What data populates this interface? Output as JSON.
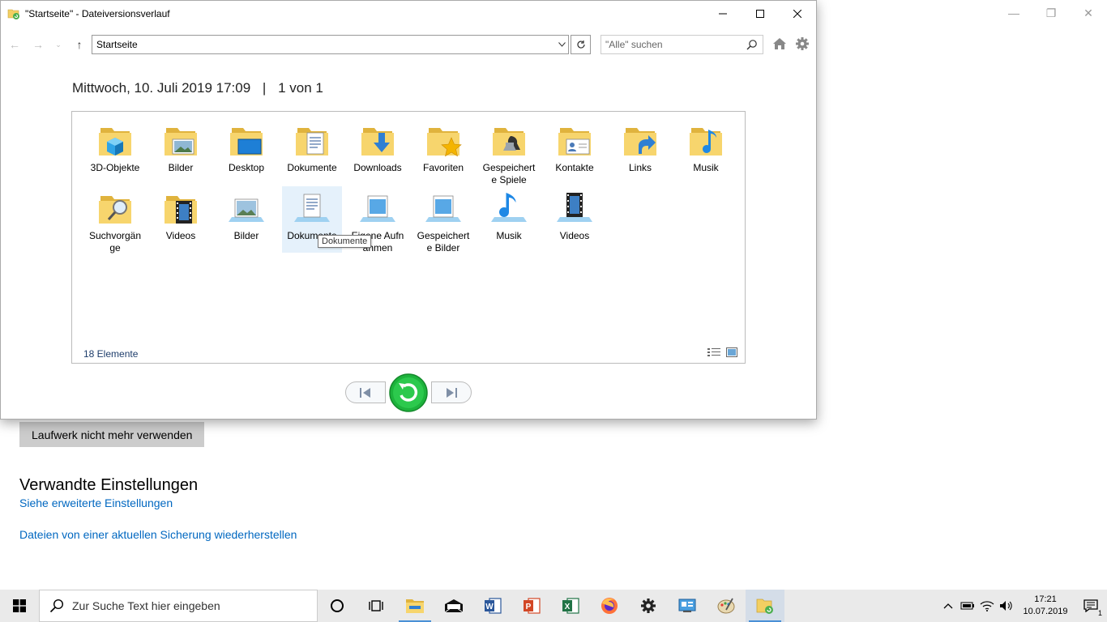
{
  "settings_app": {
    "drive_button": "Laufwerk nicht mehr verwenden",
    "related_title": "Verwandte Einstellungen",
    "link_advanced": "Siehe erweiterte Einstellungen",
    "link_restore": "Dateien von einer aktuellen Sicherung wiederherstellen"
  },
  "window": {
    "title": "\"Startseite\" - Dateiversionsverlauf",
    "address": "Startseite",
    "search_placeholder": "\"Alle\" suchen",
    "date_label": "Mittwoch, 10. Juli 2019 17:09",
    "separator": "|",
    "page_info": "1 von 1",
    "item_count": "18 Elemente",
    "tooltip": "Dokumente",
    "items_row1": [
      {
        "label": "3D-Objekte",
        "icon": "3d-objects-folder-icon"
      },
      {
        "label": "Bilder",
        "icon": "pictures-folder-icon"
      },
      {
        "label": "Desktop",
        "icon": "desktop-folder-icon"
      },
      {
        "label": "Dokumente",
        "icon": "documents-folder-icon"
      },
      {
        "label": "Downloads",
        "icon": "downloads-folder-icon"
      },
      {
        "label": "Favoriten",
        "icon": "favorites-folder-icon"
      },
      {
        "label": "Gespeicherte Spiele",
        "icon": "saved-games-folder-icon"
      },
      {
        "label": "Kontakte",
        "icon": "contacts-folder-icon"
      },
      {
        "label": "Links",
        "icon": "links-folder-icon"
      },
      {
        "label": "Musik",
        "icon": "music-folder-icon"
      }
    ],
    "items_row2": [
      {
        "label": "Suchvorgänge",
        "icon": "searches-folder-icon"
      },
      {
        "label": "Videos",
        "icon": "videos-folder-icon"
      },
      {
        "label": "Bilder",
        "icon": "pictures-library-icon"
      },
      {
        "label": "Dokumente",
        "icon": "documents-library-icon"
      },
      {
        "label": "Eigene Aufnahmen",
        "icon": "camera-roll-library-icon"
      },
      {
        "label": "Gespeicherte Bilder",
        "icon": "saved-pictures-library-icon"
      },
      {
        "label": "Musik",
        "icon": "music-library-icon"
      },
      {
        "label": "Videos",
        "icon": "videos-library-icon"
      }
    ]
  },
  "taskbar": {
    "search_placeholder": "Zur Suche Text hier eingeben",
    "time": "17:21",
    "date": "10.07.2019",
    "notifications": "1"
  },
  "colors": {
    "link": "#0067c0",
    "folder": "#f3cf62",
    "restore_green": "#1db33c",
    "selection": "#e5f1fb"
  }
}
